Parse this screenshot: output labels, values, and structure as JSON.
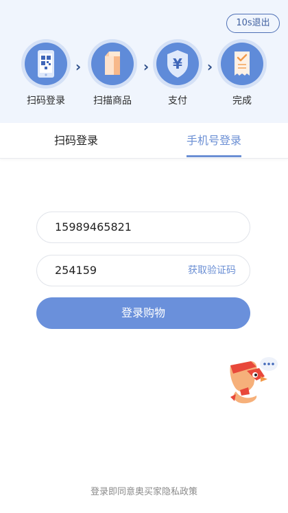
{
  "header": {
    "exit_label": "10s退出"
  },
  "steps": [
    {
      "label": "扫码登录",
      "icon": "phone-qrcode-icon"
    },
    {
      "label": "扫描商品",
      "icon": "product-box-icon"
    },
    {
      "label": "支付",
      "icon": "yuan-shield-icon"
    },
    {
      "label": "完成",
      "icon": "receipt-check-icon"
    }
  ],
  "tabs": {
    "scan_label": "扫码登录",
    "phone_label": "手机号登录",
    "active": "phone"
  },
  "form": {
    "phone_value": "15989465821",
    "code_value": "254159",
    "get_code_label": "获取验证码",
    "submit_label": "登录购物"
  },
  "footer": {
    "privacy_text": "登录即同意奥买家隐私政策"
  },
  "colors": {
    "accent": "#6a90db",
    "panel_bg": "#f0f5fd",
    "arrow": "#2e4f8a"
  }
}
